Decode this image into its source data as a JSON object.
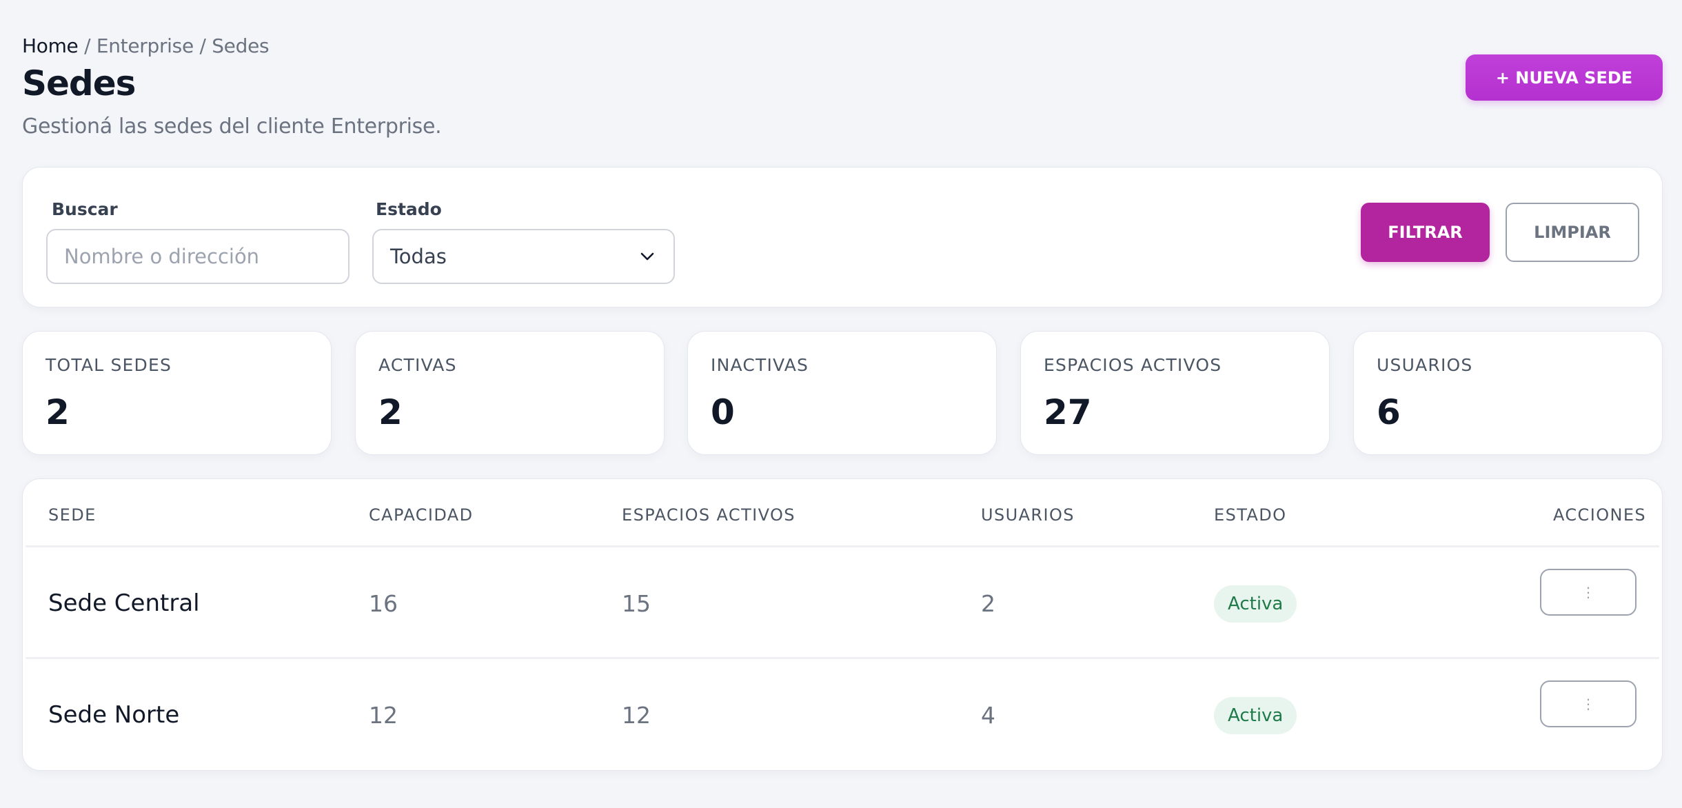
{
  "breadcrumb": {
    "home": "Home",
    "rest": " / Enterprise / Sedes"
  },
  "page": {
    "title": "Sedes",
    "subtitle": "Gestioná las sedes del cliente Enterprise.",
    "new_button": "+ NUEVA SEDE"
  },
  "filters": {
    "search_label": "Buscar",
    "search_placeholder": "Nombre o dirección",
    "status_label": "Estado",
    "status_value": "Todas",
    "filter_button": "FILTRAR",
    "clear_button": "LIMPIAR"
  },
  "stats": [
    {
      "label": "TOTAL SEDES",
      "value": "2"
    },
    {
      "label": "ACTIVAS",
      "value": "2"
    },
    {
      "label": "INACTIVAS",
      "value": "0"
    },
    {
      "label": "ESPACIOS ACTIVOS",
      "value": "27"
    },
    {
      "label": "USUARIOS",
      "value": "6"
    }
  ],
  "table": {
    "headers": [
      "SEDE",
      "CAPACIDAD",
      "ESPACIOS ACTIVOS",
      "USUARIOS",
      "ESTADO",
      "ACCIONES"
    ],
    "rows": [
      {
        "sede": "Sede Central",
        "capacidad": "16",
        "espacios": "15",
        "usuarios": "2",
        "estado": "Activa",
        "acciones_icon": "⋮"
      },
      {
        "sede": "Sede Norte",
        "capacidad": "12",
        "espacios": "12",
        "usuarios": "4",
        "estado": "Activa",
        "acciones_icon": "⋮"
      }
    ]
  },
  "colors": {
    "primary": "#b431cf",
    "filter": "#b3259f",
    "badge_bg": "#e8f5ee",
    "badge_text": "#1f7a4a"
  }
}
